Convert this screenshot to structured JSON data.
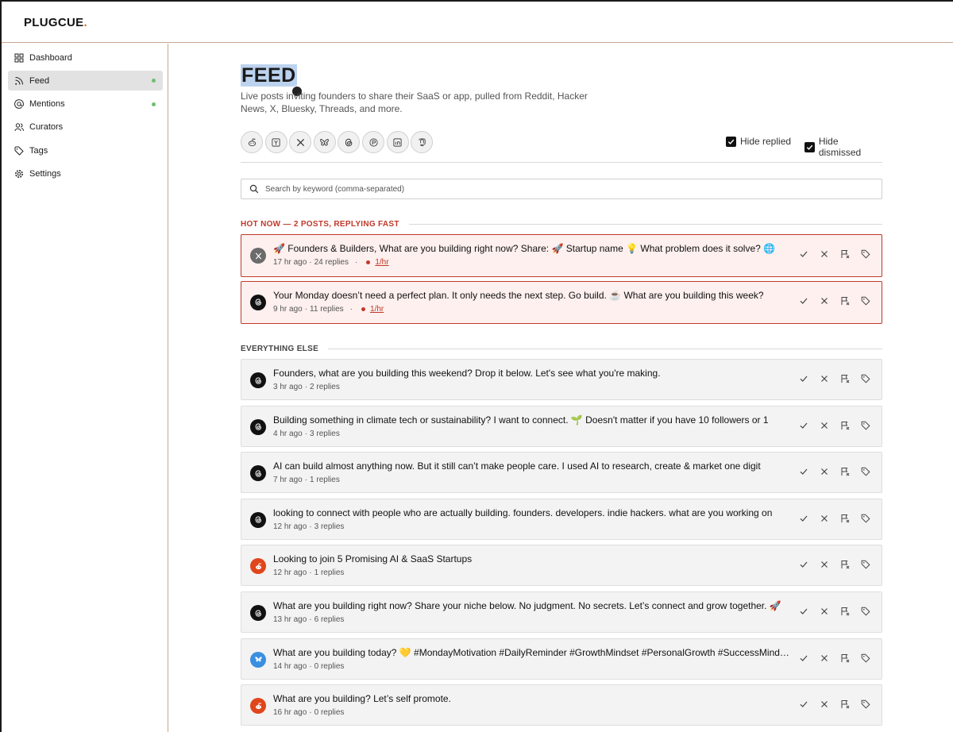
{
  "app": {
    "logo": "PLUGCUE",
    "logo_dot": "."
  },
  "sidebar": {
    "items": [
      {
        "label": "Dashboard",
        "icon": "grid-icon",
        "active": false,
        "dot": false
      },
      {
        "label": "Feed",
        "icon": "rss-icon",
        "active": true,
        "dot": true
      },
      {
        "label": "Mentions",
        "icon": "at-icon",
        "active": false,
        "dot": true
      },
      {
        "label": "Curators",
        "icon": "users-icon",
        "active": false,
        "dot": false
      },
      {
        "label": "Tags",
        "icon": "tags-icon",
        "active": false,
        "dot": false
      },
      {
        "label": "Settings",
        "icon": "gear-icon",
        "active": false,
        "dot": false
      }
    ],
    "dot_color": "#6cc070"
  },
  "page": {
    "title": "FEED",
    "subtitle": "Live posts inviting founders to share their SaaS or app, pulled from Reddit, Hacker News, X, Bluesky, Threads, and more."
  },
  "sources": [
    "reddit-icon",
    "hacker-news-icon",
    "x-icon",
    "bluesky-icon",
    "threads-icon",
    "producthunt-icon",
    "linkedin-icon",
    "mastodon-icon"
  ],
  "filters": {
    "hide_replied": {
      "label": "Hide replied",
      "checked": true
    },
    "hide_dismissed": {
      "label": "Hide dismissed",
      "checked": true
    }
  },
  "search": {
    "placeholder": "Search by keyword (comma-separated)",
    "value": ""
  },
  "hot_section": {
    "label": "HOT NOW — 2 POSTS, REPLYING FAST",
    "color": "#c0392b"
  },
  "hot_posts": [
    {
      "source": "x",
      "title": "🚀 Founders & Builders, What are you building right now? Share: 🚀 Startup name 💡 What problem does it solve? 🌐",
      "age": "17 hr ago",
      "replies": "24 replies",
      "rate": "1/hr"
    },
    {
      "source": "threads",
      "title": "Your Monday doesn’t need a perfect plan. It only needs the next step. Go build. ☕ What are you building this week?",
      "age": "9 hr ago",
      "replies": "11 replies",
      "rate": "1/hr"
    }
  ],
  "else_section": {
    "label": "EVERYTHING ELSE"
  },
  "posts": [
    {
      "source": "threads",
      "title": "Founders, what are you building this weekend? Drop it below. Let's see what you're making.",
      "age": "3 hr ago",
      "replies": "2 replies"
    },
    {
      "source": "threads",
      "title": "Building something in climate tech or sustainability? I want to connect. 🌱 Doesn't matter if you have 10 followers or 1",
      "age": "4 hr ago",
      "replies": "3 replies"
    },
    {
      "source": "threads",
      "title": "AI can build almost anything now. But it still can’t make people care. I used AI to research, create & market one digit",
      "age": "7 hr ago",
      "replies": "1 replies"
    },
    {
      "source": "threads",
      "title": "looking to connect with people who are actually building. founders. developers. indie hackers. what are you working on",
      "age": "12 hr ago",
      "replies": "3 replies"
    },
    {
      "source": "reddit",
      "title": "Looking to join 5 Promising AI & SaaS Startups",
      "age": "12 hr ago",
      "replies": "1 replies"
    },
    {
      "source": "threads",
      "title": "What are you building right now? Share your niche below. No judgment. No secrets. Let’s connect and grow together. 🚀",
      "age": "13 hr ago",
      "replies": "6 replies"
    },
    {
      "source": "bluesky",
      "title": "What are you building today? 💛 #MondayMotivation #DailyReminder #GrowthMindset #PersonalGrowth #SuccessMind…",
      "age": "14 hr ago",
      "replies": "0 replies"
    },
    {
      "source": "reddit",
      "title": "What are you building? Let’s self promote.",
      "age": "16 hr ago",
      "replies": "0 replies"
    }
  ],
  "source_colors": {
    "x": "#6b6b6b",
    "threads": "#111111",
    "reddit": "#e0461b",
    "bluesky": "#3b8fe0"
  },
  "actions": [
    "check-icon",
    "dismiss-icon",
    "flag-icon",
    "tag-icon"
  ]
}
